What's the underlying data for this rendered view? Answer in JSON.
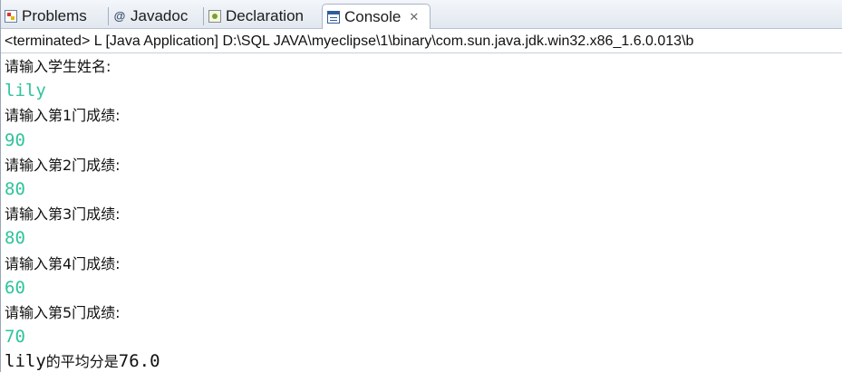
{
  "tabs": [
    {
      "label": "Problems",
      "icon": "problems-icon",
      "active": false
    },
    {
      "label": "Javadoc",
      "icon": "javadoc-icon",
      "active": false
    },
    {
      "label": "Declaration",
      "icon": "declaration-icon",
      "active": false
    },
    {
      "label": "Console",
      "icon": "console-icon",
      "active": true,
      "close": "✕"
    }
  ],
  "console": {
    "header": "<terminated> L [Java Application] D:\\SQL  JAVA\\myeclipse\\1\\binary\\com.sun.java.jdk.win32.x86_1.6.0.013\\b",
    "lines": [
      {
        "type": "prompt",
        "text": "请输入学生姓名:"
      },
      {
        "type": "input",
        "text": "lily"
      },
      {
        "type": "prompt",
        "text": "请输入第1门成绩:"
      },
      {
        "type": "input",
        "text": "90"
      },
      {
        "type": "prompt",
        "text": "请输入第2门成绩:"
      },
      {
        "type": "input",
        "text": "80"
      },
      {
        "type": "prompt",
        "text": "请输入第3门成绩:"
      },
      {
        "type": "input",
        "text": "80"
      },
      {
        "type": "prompt",
        "text": "请输入第4门成绩:"
      },
      {
        "type": "input",
        "text": "60"
      },
      {
        "type": "prompt",
        "text": "请输入第5门成绩:"
      },
      {
        "type": "input",
        "text": "70"
      }
    ],
    "result": {
      "name": "lily",
      "label": "的平均分是",
      "value": "76.0"
    }
  },
  "colors": {
    "input_text": "#2fc39b",
    "output_text": "#111111",
    "tab_bar": "#e2e8f0"
  }
}
